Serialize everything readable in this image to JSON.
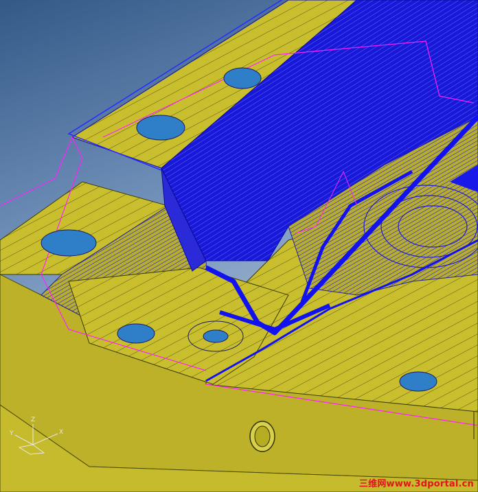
{
  "viewport": {
    "view": "3D isometric CAD/CAM mold toolpath view"
  },
  "colors": {
    "background_top": "#3a6090",
    "background_bottom": "#a9bfd8",
    "part_face": "#c9bf2e",
    "part_face_dark": "#a99f20",
    "part_side": "#b8ad28",
    "toolpath": "#1010e0",
    "toolpath_light": "#3535ff",
    "link_moves": "#ff20ff",
    "hole": "#2f7ec8",
    "edge": "#5a5a00"
  },
  "triad": {
    "z_label": "Z",
    "x_label": "X",
    "y_label": "Y"
  },
  "watermark": {
    "text": "三维网www.3dportal.cn"
  }
}
